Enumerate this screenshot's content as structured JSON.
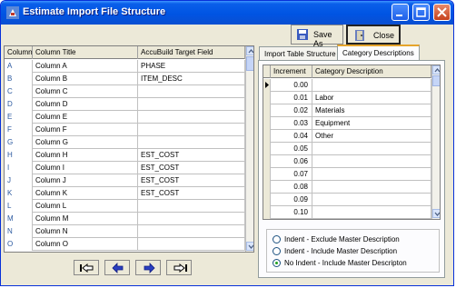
{
  "window": {
    "title": "Estimate Import File Structure"
  },
  "toolbar": {
    "save_as_label": "Save As",
    "close_label": "Close"
  },
  "left_grid": {
    "headers": [
      "Column",
      "Column Title",
      "AccuBuild Target Field"
    ],
    "rows": [
      {
        "col": "A",
        "title": "Column A",
        "target": "PHASE"
      },
      {
        "col": "B",
        "title": "Column B",
        "target": "ITEM_DESC"
      },
      {
        "col": "C",
        "title": "Column C",
        "target": ""
      },
      {
        "col": "D",
        "title": "Column D",
        "target": ""
      },
      {
        "col": "E",
        "title": "Column E",
        "target": ""
      },
      {
        "col": "F",
        "title": "Column F",
        "target": ""
      },
      {
        "col": "G",
        "title": "Column G",
        "target": ""
      },
      {
        "col": "H",
        "title": "Column H",
        "target": "EST_COST"
      },
      {
        "col": "I",
        "title": "Column I",
        "target": "EST_COST"
      },
      {
        "col": "J",
        "title": "Column J",
        "target": "EST_COST"
      },
      {
        "col": "K",
        "title": "Column K",
        "target": "EST_COST"
      },
      {
        "col": "L",
        "title": "Column L",
        "target": ""
      },
      {
        "col": "M",
        "title": "Column M",
        "target": ""
      },
      {
        "col": "N",
        "title": "Column N",
        "target": ""
      },
      {
        "col": "O",
        "title": "Column O",
        "target": ""
      }
    ]
  },
  "tabs": [
    {
      "label": "Import Table Structure",
      "active": false
    },
    {
      "label": "Category Descriptions",
      "active": true
    }
  ],
  "right_grid": {
    "headers": [
      "Increment",
      "Category Description"
    ],
    "rows": [
      {
        "inc": "0.00",
        "desc": ""
      },
      {
        "inc": "0.01",
        "desc": "Labor"
      },
      {
        "inc": "0.02",
        "desc": "Materials"
      },
      {
        "inc": "0.03",
        "desc": "Equipment"
      },
      {
        "inc": "0.04",
        "desc": "Other"
      },
      {
        "inc": "0.05",
        "desc": ""
      },
      {
        "inc": "0.06",
        "desc": ""
      },
      {
        "inc": "0.07",
        "desc": ""
      },
      {
        "inc": "0.08",
        "desc": ""
      },
      {
        "inc": "0.09",
        "desc": ""
      },
      {
        "inc": "0.10",
        "desc": ""
      }
    ]
  },
  "radio_options": [
    {
      "label": "Indent - Exclude Master Description",
      "checked": false
    },
    {
      "label": "Indent - Include Master Description",
      "checked": false
    },
    {
      "label": "No Indent - Include Master Descripton",
      "checked": true
    }
  ],
  "nav_buttons": [
    "first-record-icon",
    "previous-record-icon",
    "next-record-icon",
    "last-record-icon"
  ],
  "colors": {
    "title_bar": "#0054e3",
    "window_bg": "#ece9d8",
    "grid_letter": "#2c5aa0"
  }
}
